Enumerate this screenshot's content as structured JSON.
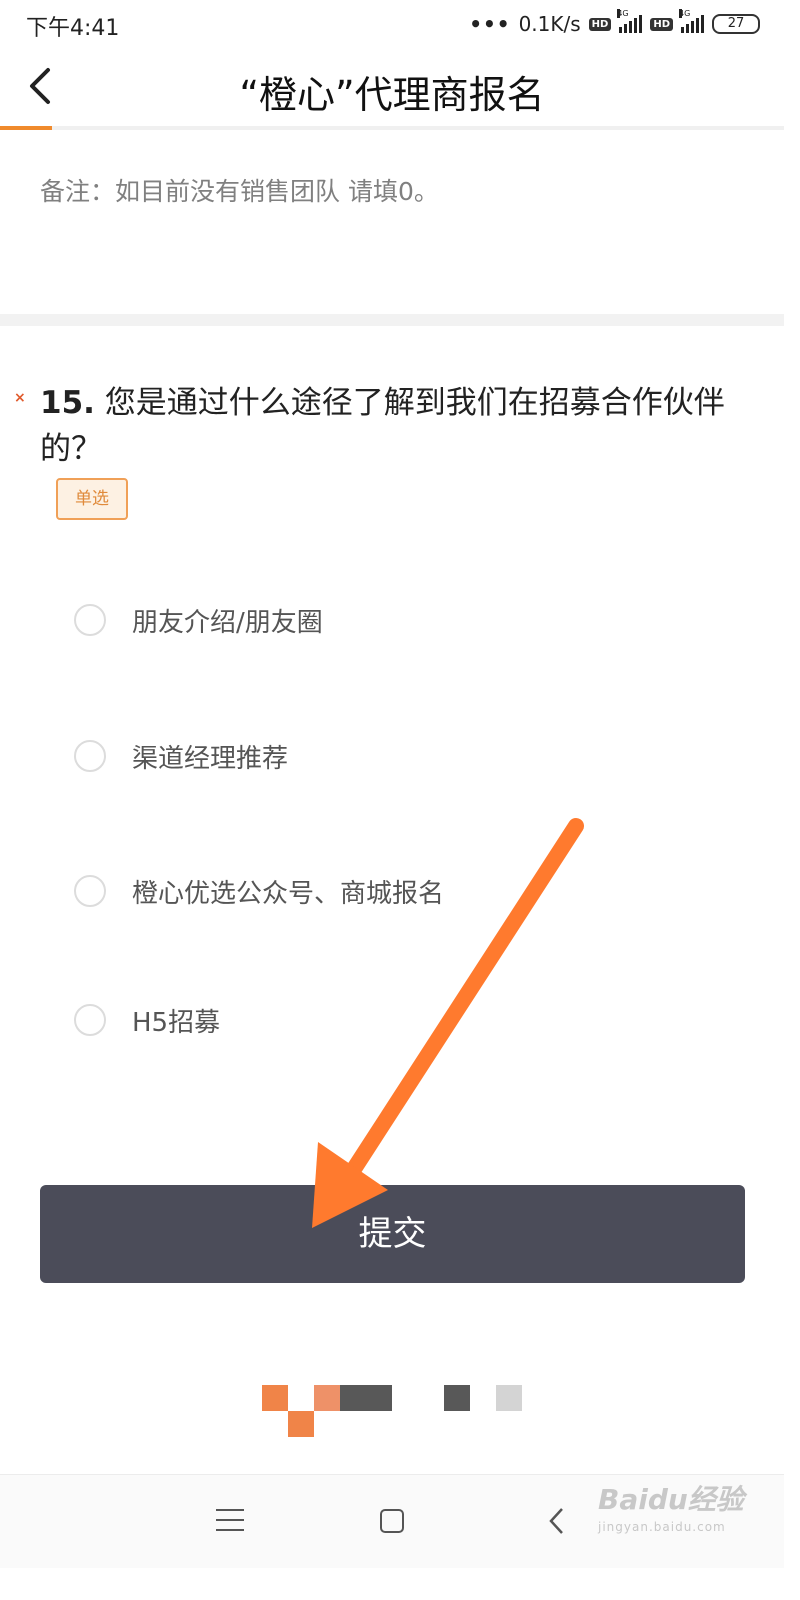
{
  "status_bar": {
    "time": "下午4:41",
    "dots": "•••",
    "network_speed": "0.1K/s",
    "hd_label": "HD",
    "net_type": "4G",
    "battery": "27"
  },
  "header": {
    "title": "“橙心”代理商报名",
    "accent_color": "#f08a2c"
  },
  "note": "备注：如目前没有销售团队  请填0。",
  "question": {
    "required_mark": "×",
    "number": "15.",
    "text": " 您是通过什么途径了解到我们在招募合作伙伴的？",
    "type_badge": "单选",
    "options": [
      {
        "label": "朋友介绍/朋友圈",
        "selected": false
      },
      {
        "label": "渠道经理推荐",
        "selected": false
      },
      {
        "label": "橙心优选公众号、商城报名",
        "selected": false
      },
      {
        "label": "H5招募",
        "selected": false
      }
    ]
  },
  "submit_label": "提交",
  "colors": {
    "submit_bg": "#4b4c59",
    "annotation_arrow": "#ff7a2e",
    "badge_border": "#f0a057"
  },
  "watermark": {
    "top": "Baidu经验",
    "bottom": "jingyan.baidu.com"
  }
}
